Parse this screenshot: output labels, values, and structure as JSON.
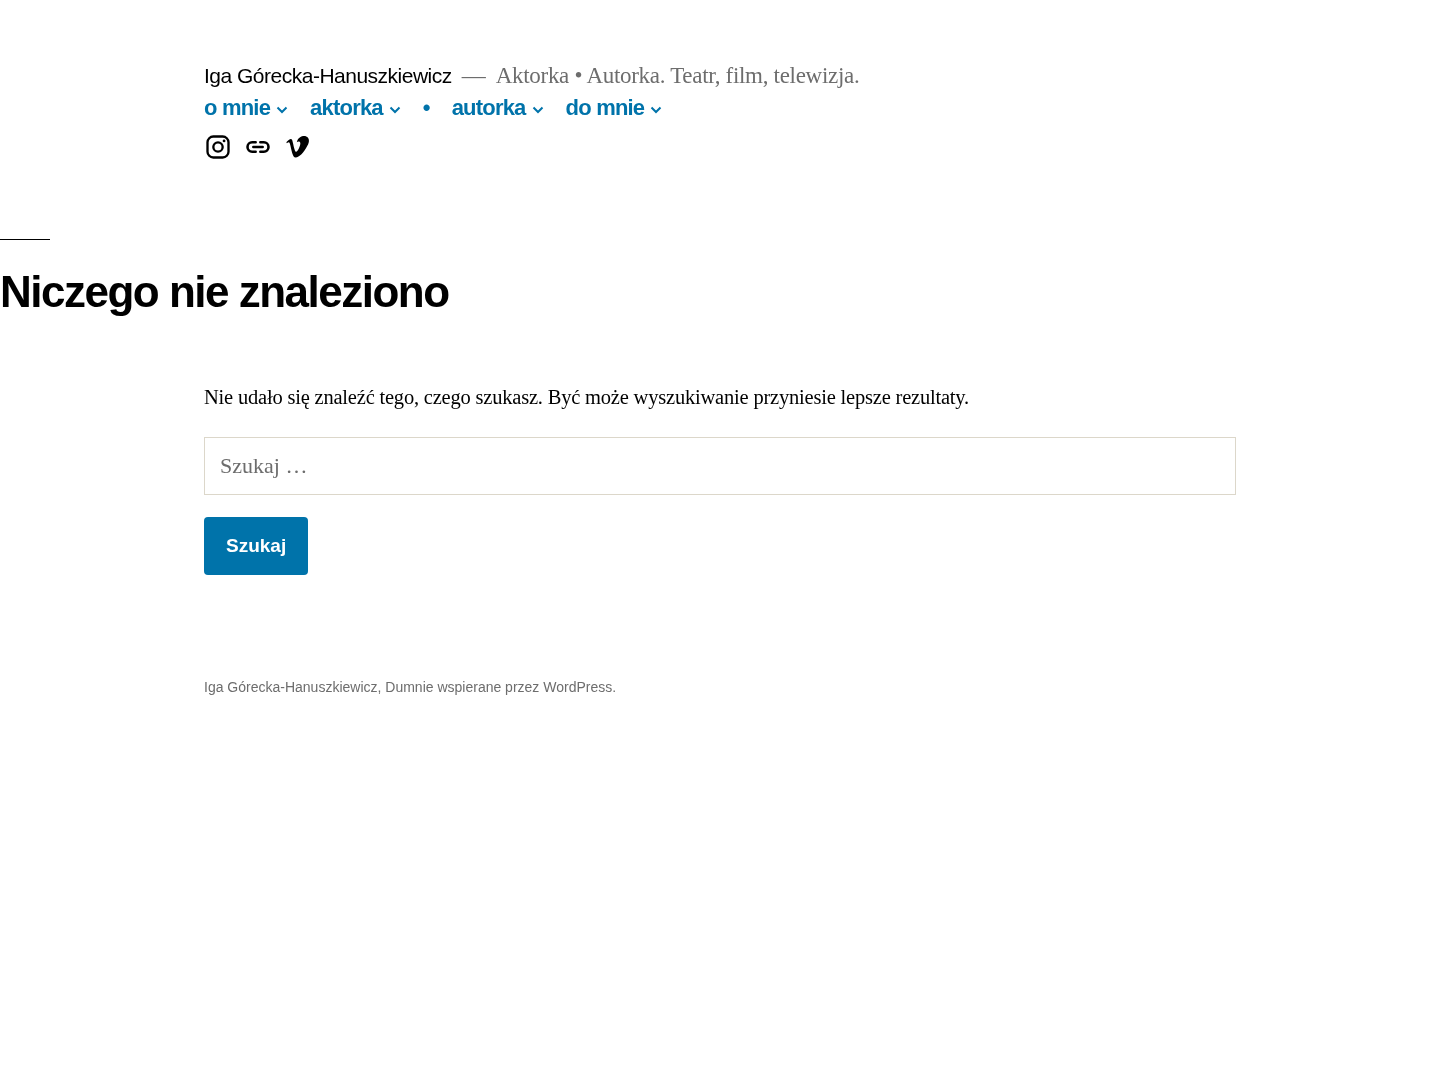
{
  "header": {
    "site_title": "Iga Górecka-Hanuszkiewicz",
    "dash": "—",
    "tagline": "Aktorka • Autorka. Teatr, film, telewizja."
  },
  "nav": [
    {
      "label": "o mnie",
      "has_submenu": true
    },
    {
      "label": "aktorka",
      "has_submenu": true
    },
    {
      "label": "•",
      "has_submenu": false
    },
    {
      "label": "autorka",
      "has_submenu": true
    },
    {
      "label": "do mnie",
      "has_submenu": true
    }
  ],
  "social": [
    {
      "kind": "instagram"
    },
    {
      "kind": "link"
    },
    {
      "kind": "vimeo"
    }
  ],
  "page": {
    "title": "Niczego nie znaleziono",
    "message": "Nie udało się znaleźć tego, czego szukasz. Być może wyszukiwanie przyniesie lepsze rezultaty.",
    "search": {
      "placeholder": "Szukaj …",
      "button": "Szukaj"
    }
  },
  "footer": {
    "text": "Iga Górecka-Hanuszkiewicz, Dumnie wspierane przez WordPress."
  }
}
